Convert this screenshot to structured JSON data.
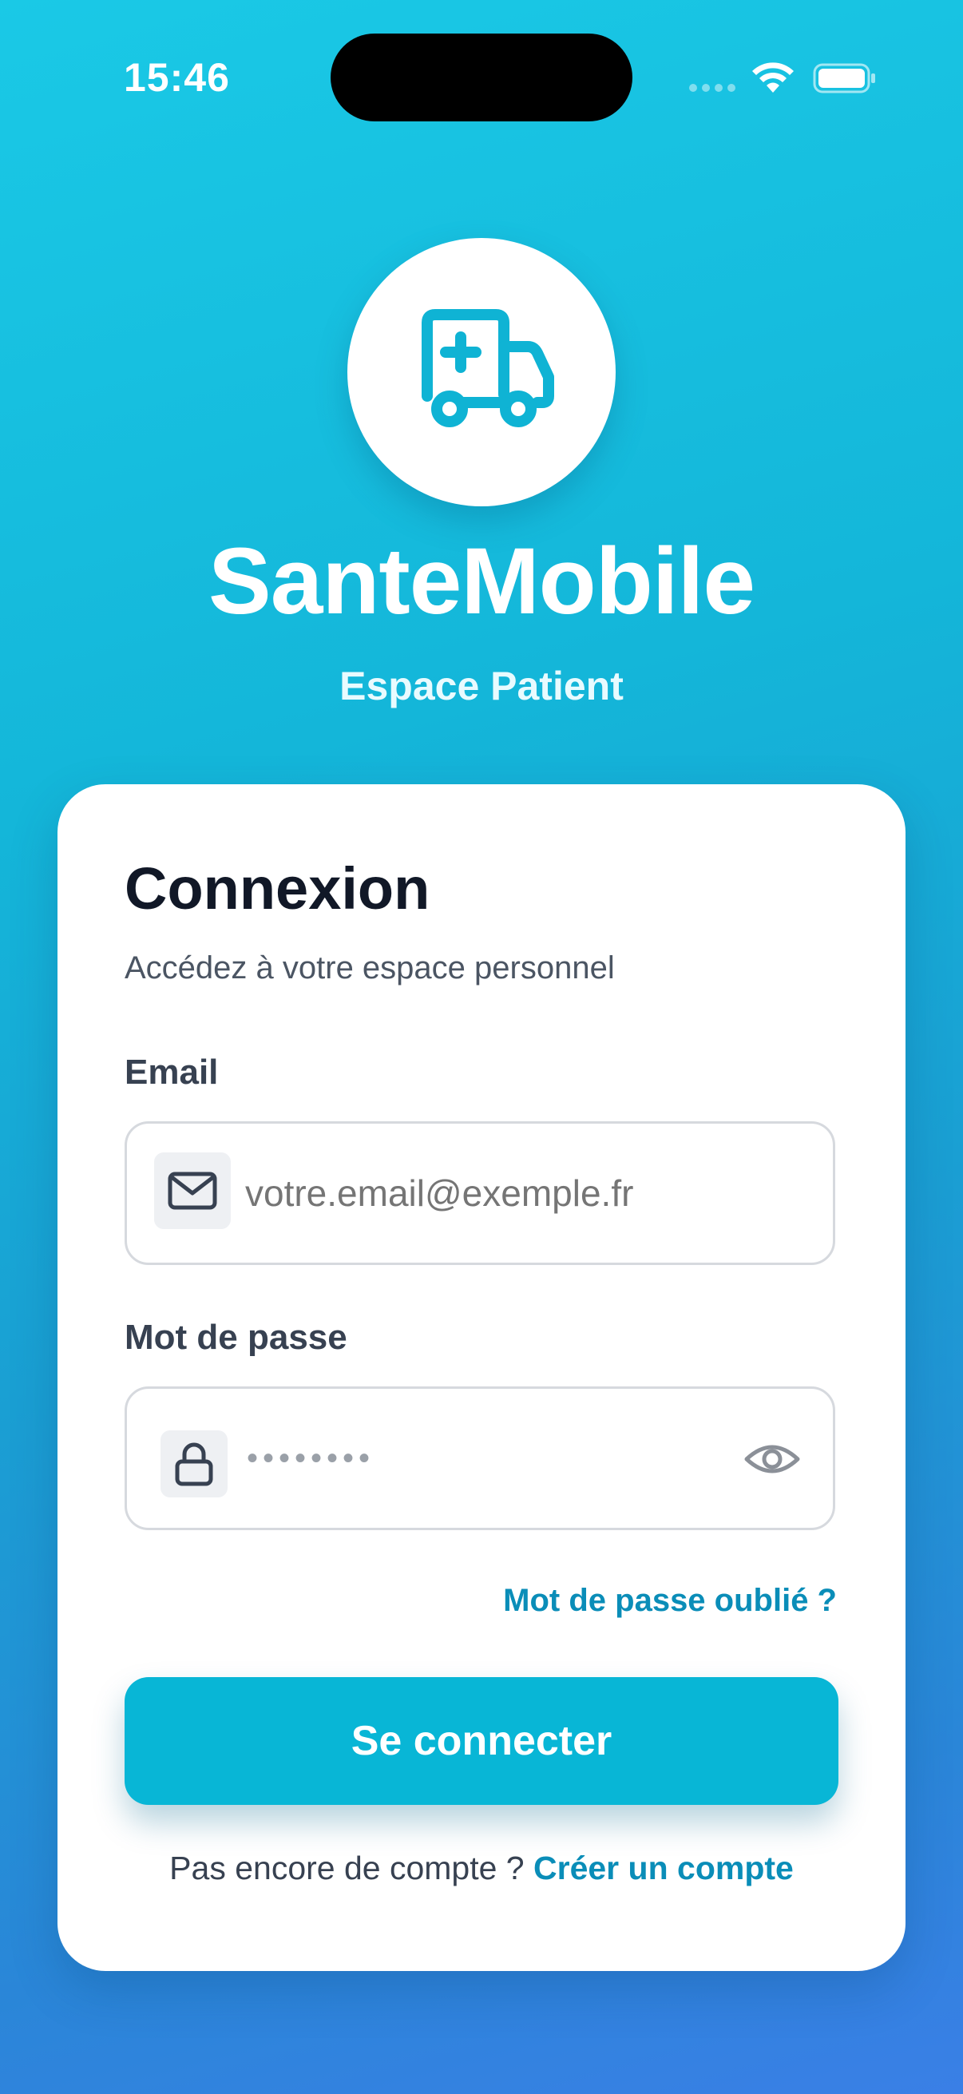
{
  "status_bar": {
    "time": "15:46"
  },
  "header": {
    "app_name": "SanteMobile",
    "tagline": "Espace Patient",
    "logo_icon": "ambulance-icon"
  },
  "login_card": {
    "title": "Connexion",
    "subtitle": "Accédez à votre espace personnel",
    "email": {
      "label": "Email",
      "placeholder": "votre.email@exemple.fr",
      "value": "",
      "icon": "mail-icon"
    },
    "password": {
      "label": "Mot de passe",
      "masked_value": "••••••••",
      "icon": "lock-icon",
      "toggle_icon": "eye-icon"
    },
    "forgot_password": "Mot de passe oublié ?",
    "submit_label": "Se connecter",
    "signup_prompt": "Pas encore de compte ?",
    "signup_link": "Créer un compte"
  },
  "colors": {
    "accent": "#08b6d6",
    "link": "#0a8db8",
    "background_top": "#1ac9e6",
    "background_bottom": "#3a7fe6"
  }
}
